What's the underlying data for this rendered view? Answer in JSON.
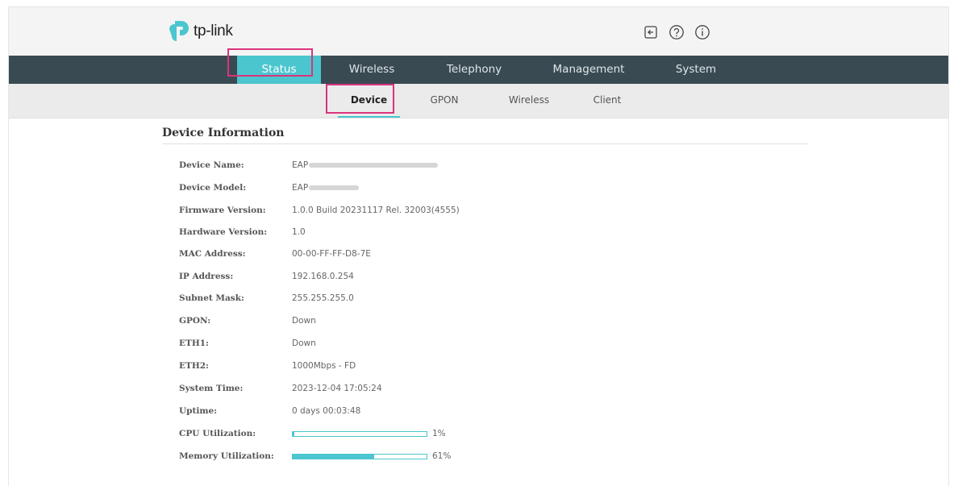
{
  "brand": {
    "name": "tp-link"
  },
  "header_icons": [
    "logout-icon",
    "help-icon",
    "about-icon"
  ],
  "main_nav": [
    {
      "label": "Status",
      "active": true
    },
    {
      "label": "Wireless",
      "active": false
    },
    {
      "label": "Telephony",
      "active": false
    },
    {
      "label": "Management",
      "active": false
    },
    {
      "label": "System",
      "active": false
    }
  ],
  "sub_nav": [
    {
      "label": "Device",
      "active": true
    },
    {
      "label": "GPON",
      "active": false
    },
    {
      "label": "Wireless",
      "active": false
    },
    {
      "label": "Client",
      "active": false
    }
  ],
  "section": {
    "title": "Device Information"
  },
  "fields": [
    {
      "label": "Device Name:",
      "value": "EAP"
    },
    {
      "label": "Device Model:",
      "value": "EAP"
    },
    {
      "label": "Firmware Version:",
      "value": "1.0.0 Build 20231117 Rel. 32003(4555)"
    },
    {
      "label": "Hardware Version:",
      "value": "1.0"
    },
    {
      "label": "MAC Address:",
      "value": "00-00-FF-FF-D8-7E"
    },
    {
      "label": "IP Address:",
      "value": "192.168.0.254"
    },
    {
      "label": "Subnet Mask:",
      "value": "255.255.255.0"
    },
    {
      "label": "GPON:",
      "value": "Down"
    },
    {
      "label": "ETH1:",
      "value": "Down"
    },
    {
      "label": "ETH2:",
      "value": "1000Mbps - FD"
    },
    {
      "label": "System Time:",
      "value": "2023-12-04 17:05:24"
    },
    {
      "label": "Uptime:",
      "value": "0 days 00:03:48"
    }
  ],
  "utilization": [
    {
      "label": "CPU Utilization:",
      "percent": 1,
      "text": "1%"
    },
    {
      "label": "Memory Utilization:",
      "percent": 61,
      "text": "61%"
    }
  ],
  "colors": {
    "accent": "#4bc6cf",
    "nav_bg": "#3a4a52",
    "highlight": "#d9347c"
  }
}
